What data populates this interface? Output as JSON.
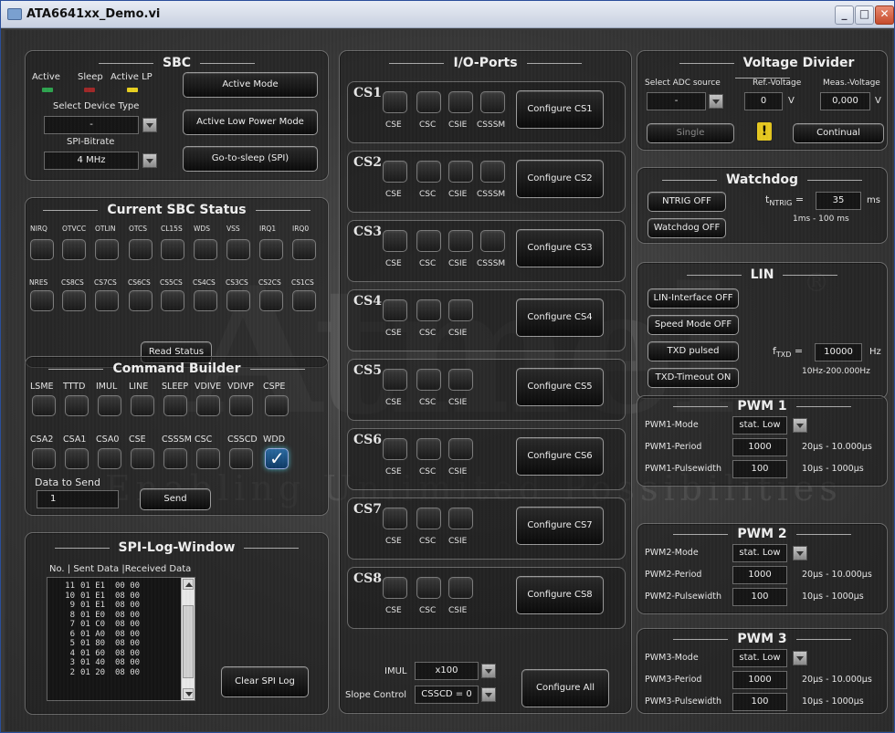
{
  "window": {
    "title": "ATA6641xx_Demo.vi",
    "min": "_",
    "max": "□",
    "close": "✕"
  },
  "watermark": {
    "brand": "Atmel",
    "tagline": "Enabling Unlimited Possibilities",
    "reg": "®"
  },
  "sbc": {
    "title": "SBC",
    "leds": [
      "Active",
      "Sleep",
      "Active LP"
    ],
    "led_colors": [
      "#2ea44f",
      "#c03030",
      "#e8d020"
    ],
    "device_label": "Select Device Type",
    "device_value": "-",
    "bitrate_label": "SPI-Bitrate",
    "bitrate_value": "4 MHz",
    "buttons": [
      "Active Mode",
      "Active Low Power Mode",
      "Go-to-sleep (SPI)"
    ]
  },
  "status": {
    "title": "Current SBC Status",
    "row1": [
      "NIRQ",
      "OTVCC",
      "OTLIN",
      "OTCS",
      "CL15S",
      "WDS",
      "VSS",
      "IRQ1",
      "IRQ0"
    ],
    "row2": [
      "NRES",
      "CS8CS",
      "CS7CS",
      "CS6CS",
      "CS5CS",
      "CS4CS",
      "CS3CS",
      "CS2CS",
      "CS1CS"
    ],
    "read": "Read Status"
  },
  "cmd": {
    "title": "Command Builder",
    "row1": [
      "LSME",
      "TTTD",
      "IMUL",
      "LINE",
      "SLEEP",
      "VDIVE",
      "VDIVP",
      "CSPE"
    ],
    "row2": [
      "CSA2",
      "CSA1",
      "CSA0",
      "CSE",
      "CSSSM",
      "CSC",
      "CSSCD",
      "WDD"
    ],
    "data_label": "Data to Send",
    "data_value": "1",
    "send": "Send"
  },
  "spilog": {
    "title": "SPI-Log-Window",
    "header": "No. | Sent Data |Received Data",
    "rows": [
      [
        "11",
        "01 E1",
        "00 00"
      ],
      [
        "10",
        "01 E1",
        "08 00"
      ],
      [
        "9",
        "01 E1",
        "08 00"
      ],
      [
        "8",
        "01 E0",
        "08 00"
      ],
      [
        "7",
        "01 C0",
        "08 00"
      ],
      [
        "6",
        "01 A0",
        "08 00"
      ],
      [
        "5",
        "01 80",
        "08 00"
      ],
      [
        "4",
        "01 60",
        "08 00"
      ],
      [
        "3",
        "01 40",
        "08 00"
      ],
      [
        "2",
        "01 20",
        "08 00"
      ]
    ],
    "clear": "Clear SPI Log"
  },
  "io": {
    "title": "I/O-Ports",
    "channels": [
      {
        "name": "CS1",
        "labels": [
          "CSE",
          "CSC",
          "CSIE",
          "CSSSM"
        ],
        "button": "Configure CS1"
      },
      {
        "name": "CS2",
        "labels": [
          "CSE",
          "CSC",
          "CSIE",
          "CSSSM"
        ],
        "button": "Configure CS2"
      },
      {
        "name": "CS3",
        "labels": [
          "CSE",
          "CSC",
          "CSIE",
          "CSSSM"
        ],
        "button": "Configure CS3"
      },
      {
        "name": "CS4",
        "labels": [
          "CSE",
          "CSC",
          "CSIE"
        ],
        "button": "Configure CS4"
      },
      {
        "name": "CS5",
        "labels": [
          "CSE",
          "CSC",
          "CSIE"
        ],
        "button": "Configure CS5"
      },
      {
        "name": "CS6",
        "labels": [
          "CSE",
          "CSC",
          "CSIE"
        ],
        "button": "Configure CS6"
      },
      {
        "name": "CS7",
        "labels": [
          "CSE",
          "CSC",
          "CSIE"
        ],
        "button": "Configure CS7"
      },
      {
        "name": "CS8",
        "labels": [
          "CSE",
          "CSC",
          "CSIE"
        ],
        "button": "Configure CS8"
      }
    ],
    "imul_label": "IMUL",
    "imul_value": "x100",
    "slope_label": "Slope Control",
    "slope_value": "CSSCD = 0",
    "configure_all": "Configure All"
  },
  "vdiv": {
    "title": "Voltage Divider",
    "adc_label": "Select ADC source",
    "adc_value": "-",
    "ref_label": "Ref.-Voltage",
    "ref_value": "0",
    "ref_unit": "V",
    "meas_label": "Meas.-Voltage",
    "meas_value": "0,000",
    "meas_unit": "V",
    "single": "Single",
    "warn": "!",
    "continual": "Continual"
  },
  "wd": {
    "title": "Watchdog",
    "ntrig_btn": "NTRIG OFF",
    "wd_btn": "Watchdog OFF",
    "t_label": "t",
    "t_sub": "NTRIG",
    "t_eq": "=",
    "t_value": "35",
    "t_unit": "ms",
    "range": "1ms - 100 ms"
  },
  "lin": {
    "title": "LIN",
    "buttons": [
      "LIN-Interface OFF",
      "Speed Mode OFF",
      "TXD pulsed",
      "TXD-Timeout ON"
    ],
    "f_label": "f",
    "f_sub": "TXD",
    "f_eq": "=",
    "f_value": "10000",
    "f_unit": "Hz",
    "range": "10Hz-200.000Hz"
  },
  "pwm": [
    {
      "title": "PWM 1",
      "mode_label": "PWM1-Mode",
      "mode_value": "stat. Low",
      "period_label": "PWM1-Period",
      "period_value": "1000",
      "period_range": "20µs - 10.000µs",
      "pw_label": "PWM1-Pulsewidth",
      "pw_value": "100",
      "pw_range": "10µs - 1000µs"
    },
    {
      "title": "PWM 2",
      "mode_label": "PWM2-Mode",
      "mode_value": "stat. Low",
      "period_label": "PWM2-Period",
      "period_value": "1000",
      "period_range": "20µs - 10.000µs",
      "pw_label": "PWM2-Pulsewidth",
      "pw_value": "100",
      "pw_range": "10µs - 1000µs"
    },
    {
      "title": "PWM 3",
      "mode_label": "PWM3-Mode",
      "mode_value": "stat. Low",
      "period_label": "PWM3-Period",
      "period_value": "1000",
      "period_range": "20µs - 10.000µs",
      "pw_label": "PWM3-Pulsewidth",
      "pw_value": "100",
      "pw_range": "10µs - 1000µs"
    }
  ]
}
